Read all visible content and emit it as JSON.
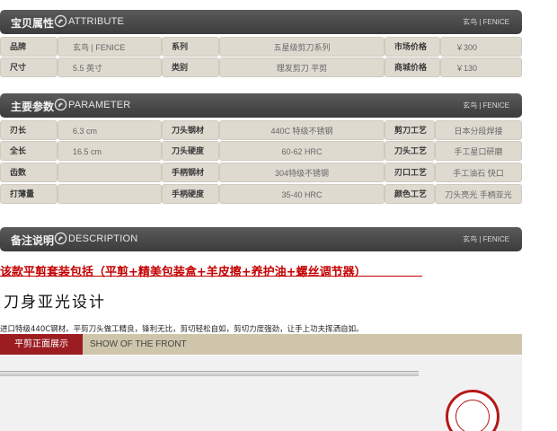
{
  "attribute": {
    "title": "宝贝属性",
    "english": "ATTRIBUTE",
    "brand": "玄鸟 | FENICE",
    "rows": [
      [
        {
          "label": "品牌",
          "value": "玄鸟 | FENICE"
        },
        {
          "label": "系列",
          "value": "五星级剪刀系列"
        },
        {
          "label": "市场价格",
          "value": "￥300"
        }
      ],
      [
        {
          "label": "尺寸",
          "value": "5.5 英寸"
        },
        {
          "label": "类别",
          "value": "理发剪刀 平剪"
        },
        {
          "label": "商城价格",
          "value": "￥130"
        }
      ]
    ]
  },
  "parameter": {
    "title": "主要参数",
    "english": "PARAMETER",
    "brand": "玄鸟 | FENICE",
    "rows": [
      [
        {
          "label": "刃长",
          "value": "6.3 cm"
        },
        {
          "label": "刀头钢材",
          "value": "440C 特级不锈钢"
        },
        {
          "label": "剪刀工艺",
          "value": "日本分段焊接"
        }
      ],
      [
        {
          "label": "全长",
          "value": "16.5 cm"
        },
        {
          "label": "刀头硬度",
          "value": "60-62 HRC"
        },
        {
          "label": "刀头工艺",
          "value": "手工星口研磨"
        }
      ],
      [
        {
          "label": "齿数",
          "value": ""
        },
        {
          "label": "手柄钢材",
          "value": "304特级不锈钢"
        },
        {
          "label": "刃口工艺",
          "value": "手工油石 快口"
        }
      ],
      [
        {
          "label": "打薄量",
          "value": ""
        },
        {
          "label": "手柄硬度",
          "value": "35-40 HRC"
        },
        {
          "label": "颜色工艺",
          "value": "刀头亮光 手柄亚光"
        }
      ]
    ]
  },
  "description": {
    "title": "备注说明",
    "english": "DESCRIPTION",
    "brand": "玄鸟 | FENICE"
  },
  "promo": "该款平剪套装包括（平剪+精美包装盒+羊皮擦+养护油+螺丝调节器）",
  "headline": "刀身亚光设计",
  "desc_text": "进口特级440C钢材。平剪刀头做工精良，锋利无比，剪切轻松自如，剪切力度强劲，让手上功夫挥洒自如。",
  "section_tab": {
    "label": "平剪正面展示",
    "english": "SHOW OF THE FRONT"
  },
  "colors": {
    "header_bar": "#474747",
    "cell_bg": "#dedad0",
    "accent_red": "#9b1d22",
    "promo_red": "#c40000",
    "tab_strip": "#cfc5ab"
  },
  "icons": [
    "dragon-icon",
    "seal-logo"
  ]
}
